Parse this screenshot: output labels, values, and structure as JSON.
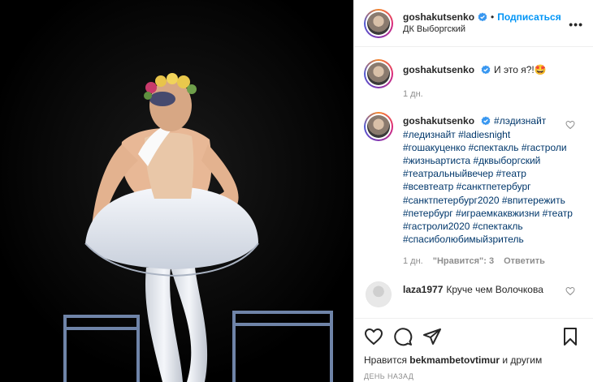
{
  "post": {
    "author": "goshakutsenko",
    "follow_label": "Подписаться",
    "location": "ДК Выборгский",
    "more_label": "•••"
  },
  "comments": [
    {
      "username": "goshakutsenko",
      "text": "И это я?!🤩",
      "time": "1 дн."
    },
    {
      "username": "goshakutsenko",
      "text": "#лэдизнайт #ледизнайт #ladiesnight #гошакуценко #спектакль #гастроли #жизньартиста #дквыборгский #театральныйвечер #театр #всевтеатр #санктпетербург #санктпетербург2020 #впитережить #петербург #играемкаквжизни #театр #гастроли2020 #спектакль #спасиболюбимыйзритель",
      "time": "1 дн.",
      "likes": "\"Нравится\": 3",
      "reply": "Ответить"
    },
    {
      "username": "laza1977",
      "text": "Круче чем Волочкова"
    }
  ],
  "footer": {
    "likes_prefix": "Нравится",
    "likes_user": "bekmambetovtimur",
    "likes_suffix": "и другим",
    "timestamp": "ДЕНЬ НАЗАД"
  },
  "icons": [
    "heart-icon",
    "comment-icon",
    "share-icon",
    "bookmark-icon",
    "verified-badge-icon"
  ],
  "colors": {
    "accent": "#0095f6",
    "hashtag": "#00376b",
    "muted": "#8e8e8e"
  }
}
